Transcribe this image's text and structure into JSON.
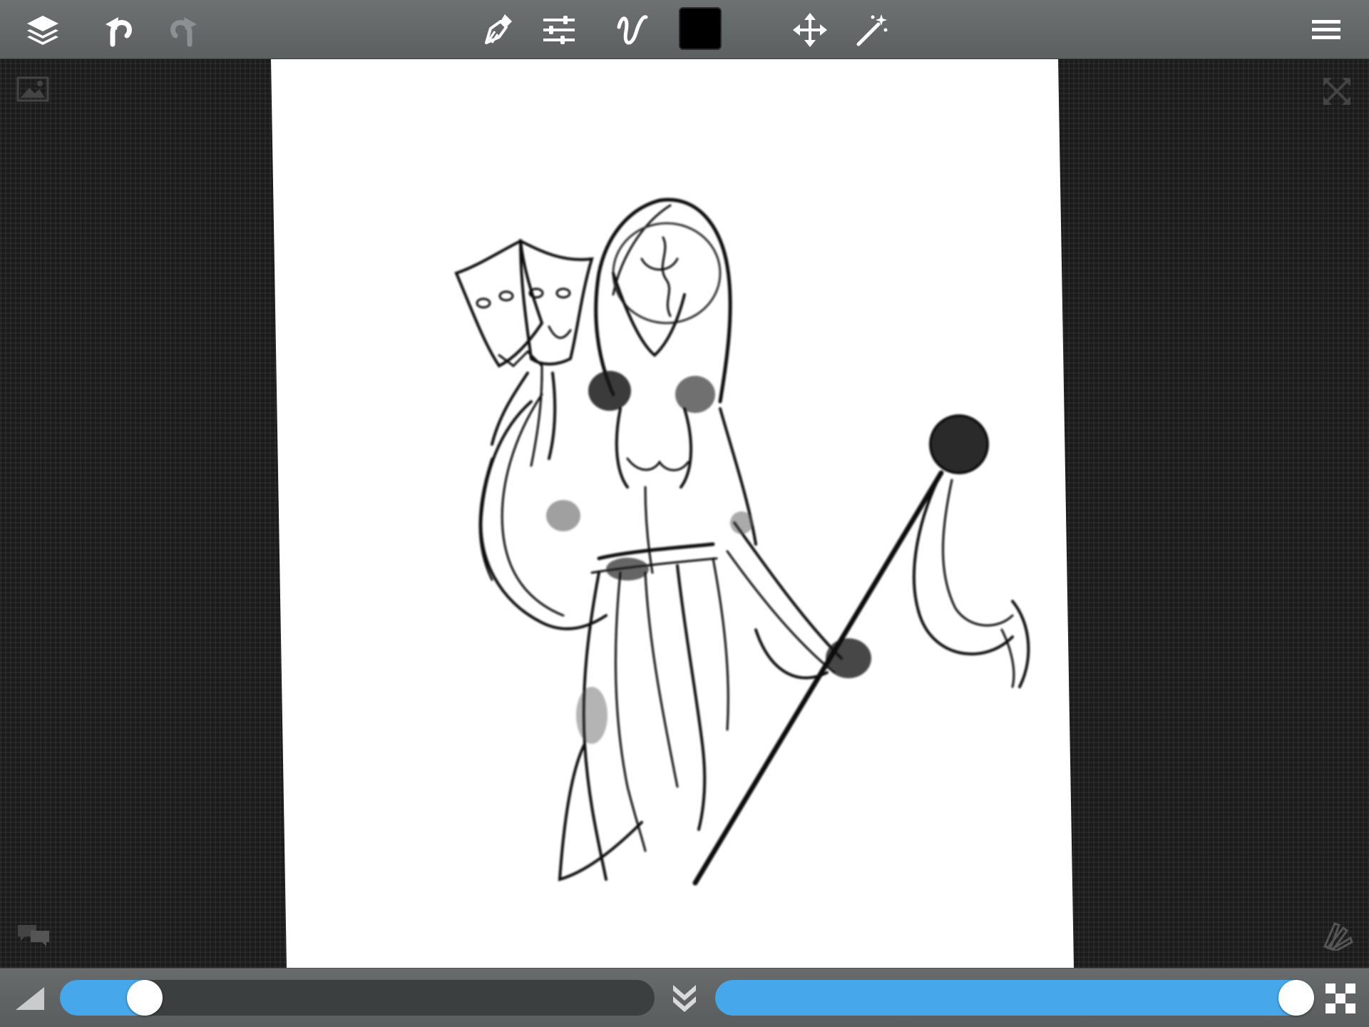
{
  "toolbar": {
    "icons": [
      "layers-icon",
      "undo-icon",
      "redo-icon",
      "brush-icon",
      "adjustments-icon",
      "stroke-icon",
      "move-icon",
      "magic-wand-icon",
      "menu-icon"
    ],
    "current_color": "#000000"
  },
  "workspace": {
    "icons": [
      "reference-image-icon",
      "fullscreen-icon",
      "chat-icon",
      "swatches-icon"
    ]
  },
  "bottombar": {
    "size_slider": {
      "value": 0.12
    },
    "opacity_slider": {
      "value": 1.0
    },
    "icons": [
      "size-triangle-icon",
      "collapse-icon",
      "opacity-checker-icon"
    ]
  },
  "colors": {
    "toolbar_bg": "#63676a",
    "accent": "#46a8ea",
    "canvas": "#ffffff",
    "workspace": "#1b1b1b"
  }
}
